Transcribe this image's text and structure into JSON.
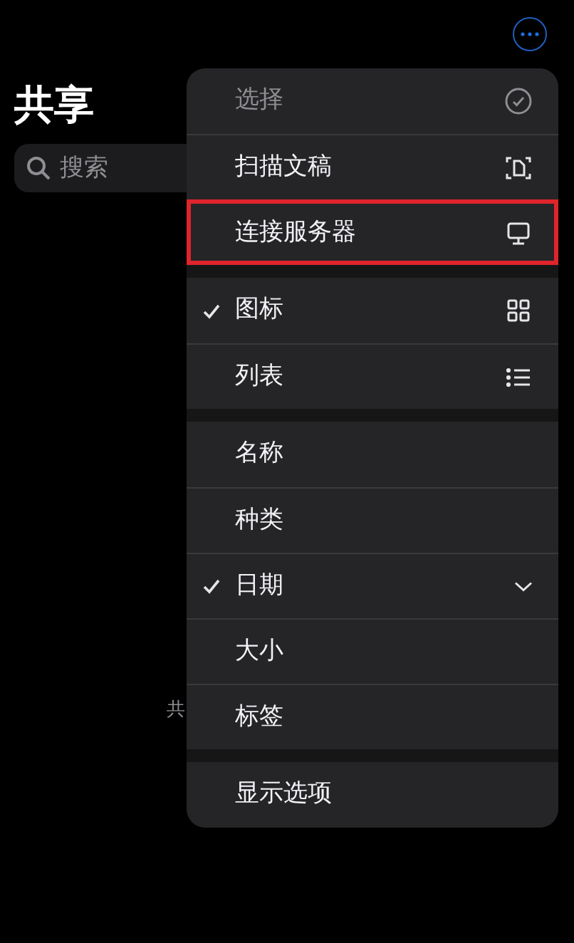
{
  "title": "共享",
  "search": {
    "placeholder": "搜索"
  },
  "empty_state": {
    "subtitle": "共"
  },
  "menu": {
    "sections": [
      {
        "items": [
          {
            "label": "选择",
            "disabled": true,
            "checked": false,
            "highlighted": false
          },
          {
            "label": "扫描文稿",
            "disabled": false,
            "checked": false,
            "highlighted": false
          },
          {
            "label": "连接服务器",
            "disabled": false,
            "checked": false,
            "highlighted": true
          }
        ]
      },
      {
        "items": [
          {
            "label": "图标",
            "disabled": false,
            "checked": true,
            "highlighted": false
          },
          {
            "label": "列表",
            "disabled": false,
            "checked": false,
            "highlighted": false
          }
        ]
      },
      {
        "items": [
          {
            "label": "名称",
            "disabled": false,
            "checked": false,
            "highlighted": false
          },
          {
            "label": "种类",
            "disabled": false,
            "checked": false,
            "highlighted": false
          },
          {
            "label": "日期",
            "disabled": false,
            "checked": true,
            "highlighted": false
          },
          {
            "label": "大小",
            "disabled": false,
            "checked": false,
            "highlighted": false
          },
          {
            "label": "标签",
            "disabled": false,
            "checked": false,
            "highlighted": false
          }
        ]
      },
      {
        "items": [
          {
            "label": "显示选项",
            "disabled": false,
            "checked": false,
            "highlighted": false
          }
        ]
      }
    ]
  }
}
